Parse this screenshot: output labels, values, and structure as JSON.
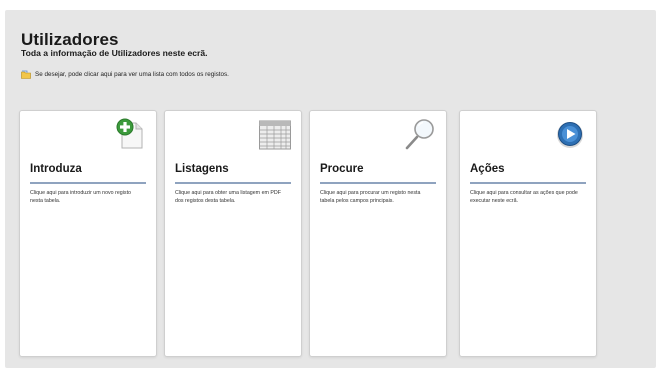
{
  "page": {
    "title": "Utilizadores",
    "subtitle": "Toda a informação de Utilizadores neste ecrã.",
    "hint": "Se desejar, pode clicar aqui para ver uma lista com todos os registos."
  },
  "cards": [
    {
      "title": "Introduza",
      "description": "Clique aqui para introduzir um novo registo nesta tabela.",
      "icon": "add-document-icon"
    },
    {
      "title": "Listagens",
      "description": "Clique aqui para obter uma listagem em PDF dos registos desta tabela.",
      "icon": "table-grid-icon"
    },
    {
      "title": "Procure",
      "description": "Clique aqui para procurar um registo nesta tabela pelos campos principais.",
      "icon": "magnifier-icon"
    },
    {
      "title": "Ações",
      "description": "Clique aqui para consultar as ações que pode executar neste ecrã.",
      "icon": "play-button-icon"
    }
  ],
  "colors": {
    "background": "#e6e6e6",
    "card_rule": "#8fa3bf",
    "add_icon_green": "#3c9a3c",
    "play_icon_blue": "#2d6fb3"
  }
}
